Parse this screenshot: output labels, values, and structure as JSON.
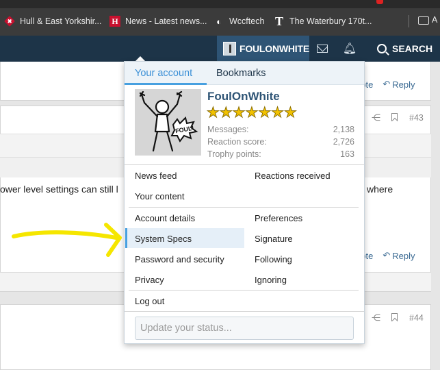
{
  "bookmarks": [
    {
      "label": "Hull & East Yorkshir...",
      "icon": "hull-live-icon"
    },
    {
      "label": "News - Latest news...",
      "icon": "h-news-icon",
      "glyph": "H"
    },
    {
      "label": "Wccftech",
      "icon": "wccftech-icon"
    },
    {
      "label": "The Waterbury 170t...",
      "icon": "t-icon",
      "glyph": "T"
    }
  ],
  "bookmarks_more_label": "A",
  "nav": {
    "username": "FOULONWHITE",
    "search_label": "SEARCH"
  },
  "posts": {
    "quote_label": "uote",
    "reply_label": "Reply",
    "post_numbers": [
      "#43",
      "#44"
    ],
    "text_left": "ower level settings can still l",
    "text_right": "where"
  },
  "menu": {
    "tabs": [
      {
        "label": "Your account",
        "active": true
      },
      {
        "label": "Bookmarks",
        "active": false
      }
    ],
    "profile": {
      "name": "FoulOnWhite",
      "star_count": 7,
      "avatar_caption": "FOUL!",
      "stats": [
        {
          "label": "Messages:",
          "value": "2,138"
        },
        {
          "label": "Reaction score:",
          "value": "2,726"
        },
        {
          "label": "Trophy points:",
          "value": "163"
        }
      ]
    },
    "links_group1": [
      "News feed",
      "Reactions received",
      "Your content"
    ],
    "links_group2": [
      "Account details",
      "Preferences",
      "System Specs",
      "Signature",
      "Password and security",
      "Following",
      "Privacy",
      "Ignoring"
    ],
    "logout_label": "Log out",
    "status_placeholder": "Update your status..."
  },
  "colors": {
    "nav_bg": "#1d3448",
    "accent": "#47a0e0",
    "annotation_arrow": "#f5e600",
    "star": "#f2c200"
  }
}
